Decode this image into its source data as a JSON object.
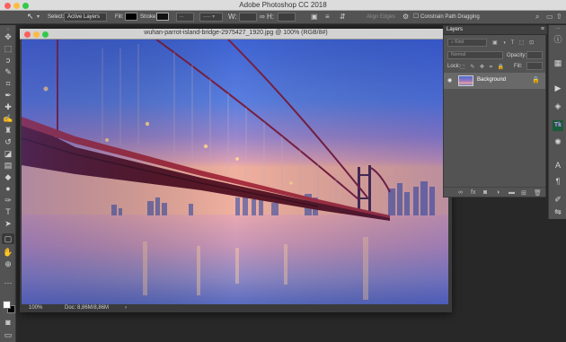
{
  "app": {
    "title": "Adobe Photoshop CC 2018"
  },
  "options_bar": {
    "select_label": "Select:",
    "select_value": "Active Layers",
    "fill_label": "Fill:",
    "stroke_label": "Stroke:",
    "align_edges_label": "Align Edges",
    "constrain_label": "Constrain Path Dragging"
  },
  "toolbar": {
    "tools": [
      "move-tool",
      "artboard-tool",
      "rectangular-marquee-tool",
      "lasso-tool",
      "magic-wand-tool",
      "crop-tool",
      "eyedropper-tool",
      "spot-healing-tool",
      "brush-tool",
      "clone-stamp-tool",
      "history-brush-tool",
      "eraser-tool",
      "gradient-tool",
      "blur-tool",
      "dodge-tool",
      "pen-tool",
      "type-tool",
      "path-selection-tool",
      "direct-selection-tool",
      "hand-tool",
      "zoom-tool",
      "more-tools"
    ]
  },
  "document": {
    "title": "wuhan-parrot-island-bridge-2975427_1920.jpg @ 100% (RGB/8#)",
    "zoom": "100%",
    "doc_info": "Doc: 8,86M/8,86M"
  },
  "layers_panel": {
    "tab": "Layers",
    "filter_placeholder": "Kind",
    "blend_mode": "Normal",
    "opacity_label": "Opacity:",
    "lock_label": "Lock:",
    "fill_label": "Fill:",
    "layers": [
      {
        "name": "Background",
        "visible": true,
        "locked": true
      }
    ]
  },
  "colors": {
    "interface_dark": "#282828",
    "panel": "#535353",
    "selected_layer": "#696969",
    "accent": "#31a8ff"
  }
}
